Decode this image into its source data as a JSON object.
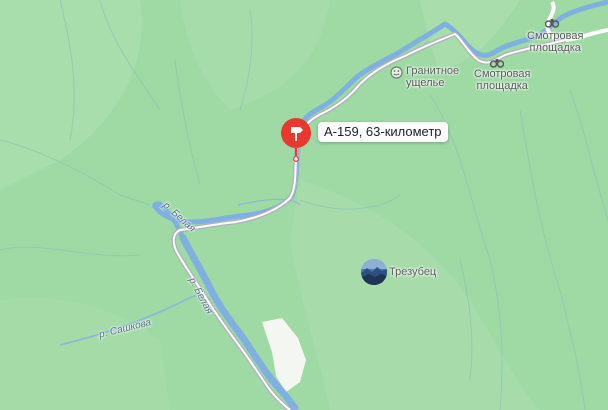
{
  "map": {
    "colors": {
      "forest": "#9fd9a4",
      "forest_light": "#b7e3b6",
      "river": "#7fb0e0",
      "road": "#a9a9b2",
      "pin": "#e8382f"
    },
    "road_marker": {
      "label": "А-159, 63-километр",
      "icon": "road-sign-icon"
    },
    "pois": [
      {
        "id": "gorge",
        "label_line1": "Гранитное",
        "label_line2": "ущелье",
        "icon": "smiley-icon"
      },
      {
        "id": "viewpoint_1",
        "label_line1": "Смотровая",
        "label_line2": "площадка",
        "icon": "binoculars-icon"
      },
      {
        "id": "viewpoint_2",
        "label_line1": "Смотровая",
        "label_line2": "площадка",
        "icon": "binoculars-icon"
      },
      {
        "id": "peak",
        "label": "Трезубец",
        "icon": "mountain-photo-icon"
      }
    ],
    "rivers": [
      {
        "label": "р. Белая"
      },
      {
        "label": "р. Белая"
      },
      {
        "label": "р. Сашкова"
      }
    ]
  }
}
